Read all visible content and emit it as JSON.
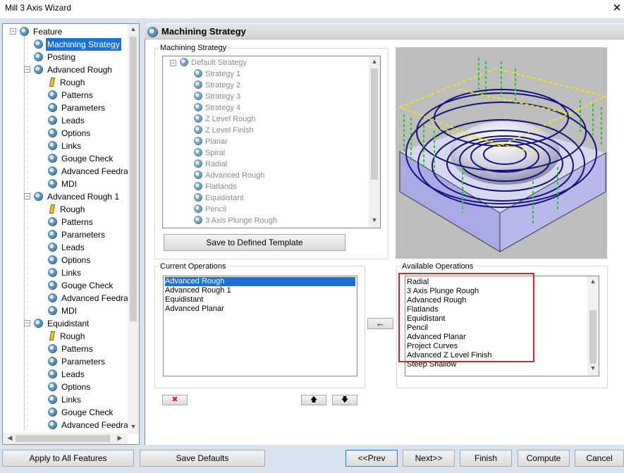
{
  "window": {
    "title": "Mill 3 Axis Wizard",
    "close_glyph": "✕"
  },
  "tree": {
    "expand_glyph": "−",
    "items": [
      {
        "label": "Feature",
        "level": 0,
        "icon": "gear-icon"
      },
      {
        "label": "Machining Strategy",
        "level": 1,
        "icon": "gear-icon",
        "selected": true
      },
      {
        "label": "Posting",
        "level": 1,
        "icon": "gear-icon"
      },
      {
        "label": "Advanced Rough",
        "level": 1,
        "icon": "gear-icon"
      },
      {
        "label": "Rough",
        "level": 2,
        "icon": "pencil-icon"
      },
      {
        "label": "Patterns",
        "level": 2,
        "icon": "gear-icon"
      },
      {
        "label": "Parameters",
        "level": 2,
        "icon": "gear-icon"
      },
      {
        "label": "Leads",
        "level": 2,
        "icon": "gear-icon"
      },
      {
        "label": "Options",
        "level": 2,
        "icon": "gear-icon"
      },
      {
        "label": "Links",
        "level": 2,
        "icon": "gear-icon"
      },
      {
        "label": "Gouge Check",
        "level": 2,
        "icon": "gear-icon"
      },
      {
        "label": "Advanced Feedrat",
        "level": 2,
        "icon": "gear-icon"
      },
      {
        "label": "MDI",
        "level": 2,
        "icon": "gear-icon"
      },
      {
        "label": "Advanced Rough 1",
        "level": 1,
        "icon": "gear-icon"
      },
      {
        "label": "Rough",
        "level": 2,
        "icon": "pencil-icon"
      },
      {
        "label": "Patterns",
        "level": 2,
        "icon": "gear-icon"
      },
      {
        "label": "Parameters",
        "level": 2,
        "icon": "gear-icon"
      },
      {
        "label": "Leads",
        "level": 2,
        "icon": "gear-icon"
      },
      {
        "label": "Options",
        "level": 2,
        "icon": "gear-icon"
      },
      {
        "label": "Links",
        "level": 2,
        "icon": "gear-icon"
      },
      {
        "label": "Gouge Check",
        "level": 2,
        "icon": "gear-icon"
      },
      {
        "label": "Advanced Feedrat",
        "level": 2,
        "icon": "gear-icon"
      },
      {
        "label": "MDI",
        "level": 2,
        "icon": "gear-icon"
      },
      {
        "label": "Equidistant",
        "level": 1,
        "icon": "gear-icon"
      },
      {
        "label": "Rough",
        "level": 2,
        "icon": "pencil-icon"
      },
      {
        "label": "Patterns",
        "level": 2,
        "icon": "gear-icon"
      },
      {
        "label": "Parameters",
        "level": 2,
        "icon": "gear-icon"
      },
      {
        "label": "Leads",
        "level": 2,
        "icon": "gear-icon"
      },
      {
        "label": "Options",
        "level": 2,
        "icon": "gear-icon"
      },
      {
        "label": "Links",
        "level": 2,
        "icon": "gear-icon"
      },
      {
        "label": "Gouge Check",
        "level": 2,
        "icon": "gear-icon"
      },
      {
        "label": "Advanced Feedrat",
        "level": 2,
        "icon": "gear-icon"
      }
    ]
  },
  "header": {
    "title": "Machining Strategy"
  },
  "strategy_group": {
    "legend": "Machining Strategy",
    "items": [
      {
        "label": "Default Strategy",
        "root": true
      },
      {
        "label": "Strategy 1"
      },
      {
        "label": "Strategy 2"
      },
      {
        "label": "Strategy 3"
      },
      {
        "label": "Strategy 4"
      },
      {
        "label": "Z Level Rough"
      },
      {
        "label": "Z Level Finish"
      },
      {
        "label": "Planar"
      },
      {
        "label": "Spiral"
      },
      {
        "label": "Radial"
      },
      {
        "label": "Advanced Rough"
      },
      {
        "label": "Flatlands"
      },
      {
        "label": "Equidistant"
      },
      {
        "label": "Pencil"
      },
      {
        "label": "3 Axis Plunge Rough"
      }
    ],
    "save_button": "Save to Defined Template"
  },
  "current_operations": {
    "legend": "Current Operations",
    "items": [
      "Advanced Rough",
      "Advanced Rough 1",
      "Equidistant",
      "Advanced Planar"
    ],
    "selected_index": 0
  },
  "available_operations": {
    "legend": "Available Operations",
    "items": [
      "Radial",
      "3 Axis Plunge Rough",
      "Advanced Rough",
      "Flatlands",
      "Equidistant",
      "Pencil",
      "Advanced Planar",
      "Project Curves",
      "Advanced Z Level Finish",
      "Steep Shallow"
    ]
  },
  "controls": {
    "add_arrow": "←",
    "delete_glyph": "✖",
    "up_glyph": "🡅",
    "down_glyph": "🡇"
  },
  "bottom": {
    "apply_all": "Apply to All Features",
    "save_defaults": "Save Defaults",
    "prev": "<<Prev",
    "next": "Next>>",
    "finish": "Finish",
    "compute": "Compute",
    "cancel": "Cancel"
  },
  "colors": {
    "accent": "#1a72d8",
    "highlight_box": "#d4232a",
    "dialog_bg": "#d9e4f0"
  }
}
